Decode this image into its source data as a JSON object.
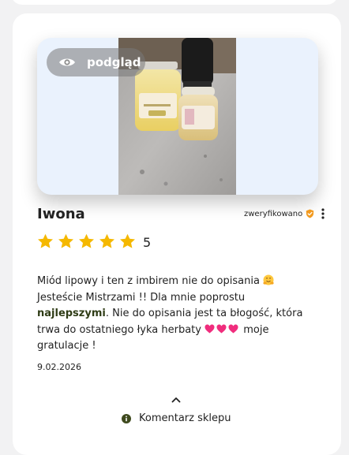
{
  "preview": {
    "label": "podgląd"
  },
  "review": {
    "author": "Iwona",
    "verified_label": "zweryfikowano",
    "rating": "5",
    "stars_filled": 5,
    "stars_total": 5,
    "text_part1": "Miód lipowy i ten z imbirem nie do opisania ",
    "text_part2": " Jesteście Mistrzami !! Dla mnie poprostu ",
    "text_bold": "najlepszymi",
    "text_part3": ". Nie do opisania jest ta błogość, która trwa do ostatniego łyka herbaty ",
    "text_part4": " moje gratulacje !",
    "date": "9.02.2026"
  },
  "shop_comment": {
    "label": "Komentarz sklepu"
  },
  "icons": {
    "preview": "eye-icon",
    "verified": "shield-check-icon",
    "more": "more-vertical-icon",
    "star": "star-icon",
    "collapse": "chevron-up-icon",
    "info": "info-icon",
    "hugging_face": "hugging-face-emoji",
    "heart": "heart-emoji"
  },
  "colors": {
    "star": "#f5b800",
    "verified_shield": "#f29a1f",
    "heart": "#f02d7d",
    "info": "#3f4a1e",
    "bold_text": "#2f3c16"
  }
}
